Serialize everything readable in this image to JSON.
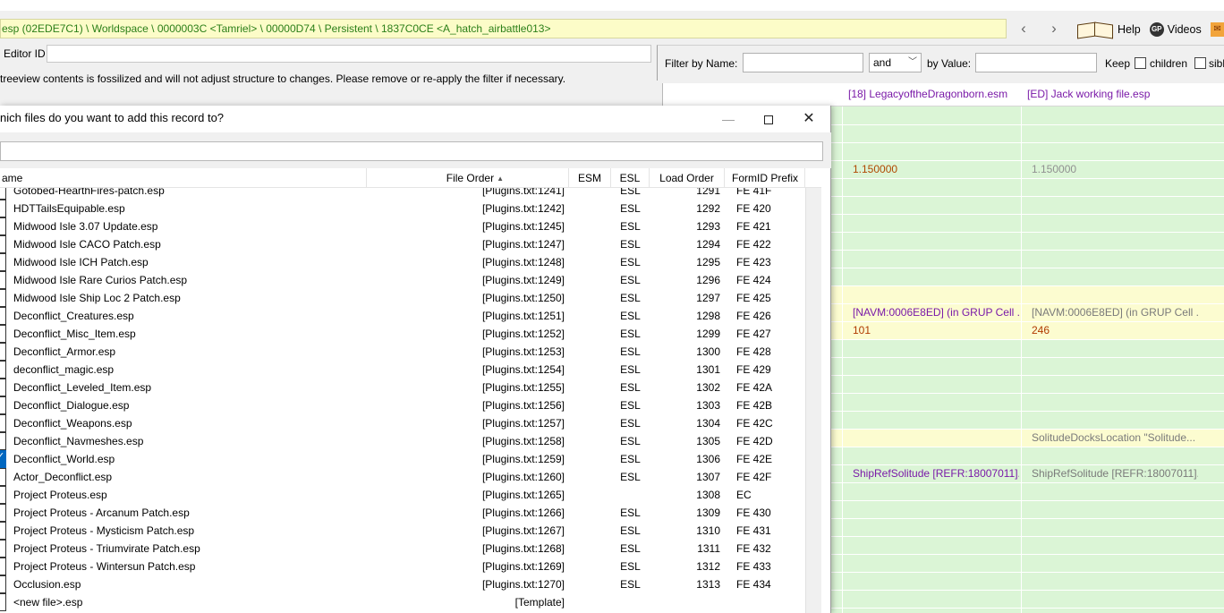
{
  "path_bar": "esp (02EDE7C1) \\ Worldspace \\ 0000003C <Tamriel> \\ 00000D74 \\ Persistent \\ 1837C0CE <A_hatch_airbattle013>",
  "nav": {
    "back": "‹",
    "forward": "›"
  },
  "help": {
    "help_label": "Help",
    "gp_icon_text": "GP",
    "videos_label": "Videos"
  },
  "editor": {
    "label": "Editor ID",
    "value": ""
  },
  "fossil_message": "treeview contents is fossilized and will not adjust structure to changes.  Please remove or re-apply the filter if necessary.",
  "filter": {
    "by_name_label": "Filter by Name:",
    "name_value": "",
    "operator": "and",
    "by_value_label": "by Value:",
    "value_value": "",
    "keep_label": "Keep",
    "children_label": "children",
    "siblings_label": "sibl"
  },
  "grid": {
    "columns": [
      "[18] LegacyoftheDragonborn.esm",
      "[ED] Jack working file.esp"
    ],
    "rows": [
      {
        "c1": "",
        "c2": "",
        "style": "green"
      },
      {
        "c1": "",
        "c2": "",
        "style": "green"
      },
      {
        "c1": "",
        "c2": "",
        "style": "green"
      },
      {
        "c1": "1.150000",
        "c2": "1.150000",
        "style": "green"
      },
      {
        "c1": "",
        "c2": "",
        "style": "green"
      },
      {
        "c1": "",
        "c2": "",
        "style": "green"
      },
      {
        "c1": "",
        "c2": "",
        "style": "green"
      },
      {
        "c1": "",
        "c2": "",
        "style": "green"
      },
      {
        "c1": "",
        "c2": "",
        "style": "green"
      },
      {
        "c1": "",
        "c2": "",
        "style": "green"
      },
      {
        "c1": "",
        "c2": "",
        "style": "yellow"
      },
      {
        "c1": "[NAVM:0006E8ED] (in GRUP Cell ...",
        "c2": "[NAVM:0006E8ED] (in GRUP Cell ...",
        "style": "yellow"
      },
      {
        "c1": "101",
        "c2": "246",
        "style": "yellow"
      },
      {
        "c1": "",
        "c2": "",
        "style": "green"
      },
      {
        "c1": "",
        "c2": "",
        "style": "green"
      },
      {
        "c1": "",
        "c2": "",
        "style": "green"
      },
      {
        "c1": "",
        "c2": "",
        "style": "green"
      },
      {
        "c1": "",
        "c2": "",
        "style": "green"
      },
      {
        "c1": "",
        "c2": "SolitudeDocksLocation \"Solitude...",
        "style": "yellow"
      },
      {
        "c1": "",
        "c2": "",
        "style": "green"
      },
      {
        "c1": "ShipRefSolitude [REFR:18007011]...",
        "c2": "ShipRefSolitude [REFR:18007011]...",
        "style": "green"
      },
      {
        "c1": "",
        "c2": "",
        "style": "green"
      },
      {
        "c1": "",
        "c2": "",
        "style": "green"
      },
      {
        "c1": "",
        "c2": "",
        "style": "green"
      },
      {
        "c1": "",
        "c2": "",
        "style": "green"
      },
      {
        "c1": "",
        "c2": "",
        "style": "green"
      },
      {
        "c1": "",
        "c2": "",
        "style": "green"
      },
      {
        "c1": "",
        "c2": "",
        "style": "green"
      }
    ]
  },
  "dialog": {
    "title": "nich files do you want to add this record to?",
    "min_glyph": "—",
    "close_glyph": "✕",
    "filter_value": "",
    "columns": {
      "name": "ame",
      "file_order": "File Order",
      "esm": "ESM",
      "esl": "ESL",
      "load_order": "Load Order",
      "prefix": "FormID Prefix"
    },
    "rows": [
      {
        "name": "Gotobed-HearthFires-patch.esp",
        "order": "[Plugins.txt:1241]",
        "esm": "",
        "esl": "ESL",
        "load": "1291",
        "prefix": "FE 41F",
        "checked": false
      },
      {
        "name": "HDTTailsEquipable.esp",
        "order": "[Plugins.txt:1242]",
        "esm": "",
        "esl": "ESL",
        "load": "1292",
        "prefix": "FE 420",
        "checked": false
      },
      {
        "name": "Midwood Isle 3.07 Update.esp",
        "order": "[Plugins.txt:1245]",
        "esm": "",
        "esl": "ESL",
        "load": "1293",
        "prefix": "FE 421",
        "checked": false
      },
      {
        "name": "Midwood Isle CACO Patch.esp",
        "order": "[Plugins.txt:1247]",
        "esm": "",
        "esl": "ESL",
        "load": "1294",
        "prefix": "FE 422",
        "checked": false
      },
      {
        "name": "Midwood Isle ICH Patch.esp",
        "order": "[Plugins.txt:1248]",
        "esm": "",
        "esl": "ESL",
        "load": "1295",
        "prefix": "FE 423",
        "checked": false
      },
      {
        "name": "Midwood Isle Rare Curios Patch.esp",
        "order": "[Plugins.txt:1249]",
        "esm": "",
        "esl": "ESL",
        "load": "1296",
        "prefix": "FE 424",
        "checked": false
      },
      {
        "name": "Midwood Isle Ship Loc 2 Patch.esp",
        "order": "[Plugins.txt:1250]",
        "esm": "",
        "esl": "ESL",
        "load": "1297",
        "prefix": "FE 425",
        "checked": false
      },
      {
        "name": "Deconflict_Creatures.esp",
        "order": "[Plugins.txt:1251]",
        "esm": "",
        "esl": "ESL",
        "load": "1298",
        "prefix": "FE 426",
        "checked": false
      },
      {
        "name": "Deconflict_Misc_Item.esp",
        "order": "[Plugins.txt:1252]",
        "esm": "",
        "esl": "ESL",
        "load": "1299",
        "prefix": "FE 427",
        "checked": false
      },
      {
        "name": "Deconflict_Armor.esp",
        "order": "[Plugins.txt:1253]",
        "esm": "",
        "esl": "ESL",
        "load": "1300",
        "prefix": "FE 428",
        "checked": false
      },
      {
        "name": "deconflict_magic.esp",
        "order": "[Plugins.txt:1254]",
        "esm": "",
        "esl": "ESL",
        "load": "1301",
        "prefix": "FE 429",
        "checked": false
      },
      {
        "name": "Deconflict_Leveled_Item.esp",
        "order": "[Plugins.txt:1255]",
        "esm": "",
        "esl": "ESL",
        "load": "1302",
        "prefix": "FE 42A",
        "checked": false
      },
      {
        "name": "Deconflict_Dialogue.esp",
        "order": "[Plugins.txt:1256]",
        "esm": "",
        "esl": "ESL",
        "load": "1303",
        "prefix": "FE 42B",
        "checked": false
      },
      {
        "name": "Deconflict_Weapons.esp",
        "order": "[Plugins.txt:1257]",
        "esm": "",
        "esl": "ESL",
        "load": "1304",
        "prefix": "FE 42C",
        "checked": false
      },
      {
        "name": "Deconflict_Navmeshes.esp",
        "order": "[Plugins.txt:1258]",
        "esm": "",
        "esl": "ESL",
        "load": "1305",
        "prefix": "FE 42D",
        "checked": false
      },
      {
        "name": "Deconflict_World.esp",
        "order": "[Plugins.txt:1259]",
        "esm": "",
        "esl": "ESL",
        "load": "1306",
        "prefix": "FE 42E",
        "checked": true
      },
      {
        "name": "Actor_Deconflict.esp",
        "order": "[Plugins.txt:1260]",
        "esm": "",
        "esl": "ESL",
        "load": "1307",
        "prefix": "FE 42F",
        "checked": false
      },
      {
        "name": "Project Proteus.esp",
        "order": "[Plugins.txt:1265]",
        "esm": "",
        "esl": "",
        "load": "1308",
        "prefix": "EC",
        "checked": false
      },
      {
        "name": "Project Proteus - Arcanum Patch.esp",
        "order": "[Plugins.txt:1266]",
        "esm": "",
        "esl": "ESL",
        "load": "1309",
        "prefix": "FE 430",
        "checked": false
      },
      {
        "name": "Project Proteus - Mysticism Patch.esp",
        "order": "[Plugins.txt:1267]",
        "esm": "",
        "esl": "ESL",
        "load": "1310",
        "prefix": "FE 431",
        "checked": false
      },
      {
        "name": "Project Proteus - Triumvirate Patch.esp",
        "order": "[Plugins.txt:1268]",
        "esm": "",
        "esl": "ESL",
        "load": "1311",
        "prefix": "FE 432",
        "checked": false
      },
      {
        "name": "Project Proteus - Wintersun Patch.esp",
        "order": "[Plugins.txt:1269]",
        "esm": "",
        "esl": "ESL",
        "load": "1312",
        "prefix": "FE 433",
        "checked": false
      },
      {
        "name": "Occlusion.esp",
        "order": "[Plugins.txt:1270]",
        "esm": "",
        "esl": "ESL",
        "load": "1313",
        "prefix": "FE 434",
        "checked": false
      },
      {
        "name": "<new file>.esp",
        "order": "[Template]",
        "esm": "",
        "esl": "",
        "load": "",
        "prefix": "",
        "checked": false
      }
    ]
  },
  "colors": {
    "path_text": "#2b7f18",
    "path_bg": "#fcfcc8",
    "grid_green": "#dbf5d6",
    "grid_yellow": "#fcfcd0",
    "plugin_header": "#7a1aa8",
    "value_primary": "#7a1aa8",
    "value_secondary": "#7a7a7a",
    "value_yellow": "#b03a00",
    "checkbox_checked": "#0067c0"
  }
}
